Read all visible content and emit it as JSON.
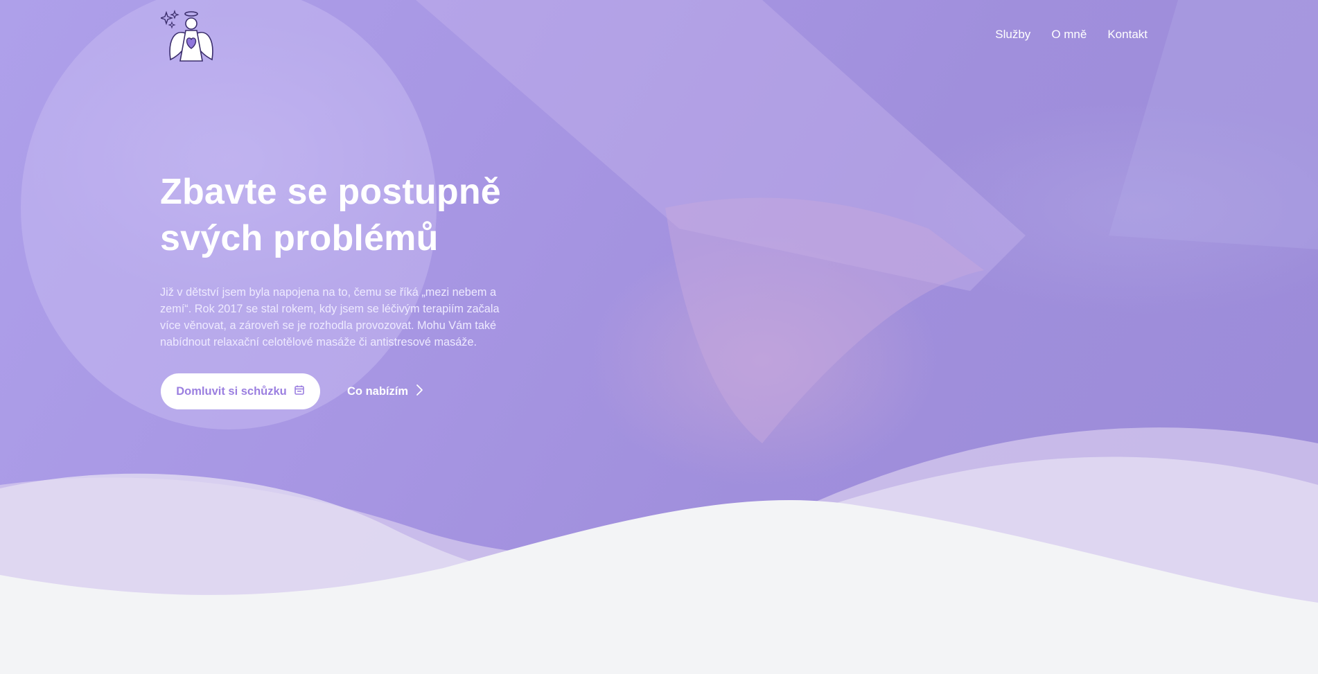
{
  "nav": {
    "logo": "angel-logo",
    "links": [
      "Služby",
      "O mně",
      "Kontakt"
    ]
  },
  "hero": {
    "title_line1": "Zbavte se postupně",
    "title_line2": "svých problémů",
    "lead": "Již v dětství jsem byla napojena na to, čemu se říká „mezi nebem a zemí“. Rok 2017 se stal rokem, kdy jsem se léčivým terapiím začala více věnovat, a zároveň se je rozhodla provozovat. Mohu Vám také nabídnout relaxační celotělové masáže či antistresové masáže.",
    "primary_button": "Domluvit si schůzku",
    "primary_icon": "calendar-icon",
    "secondary_button": "Co nabízím",
    "secondary_icon": "chevron-right-icon"
  },
  "colors": {
    "overlay": "#a08fdc",
    "accent": "#9b7fe0",
    "background": "#f3f4f6"
  }
}
